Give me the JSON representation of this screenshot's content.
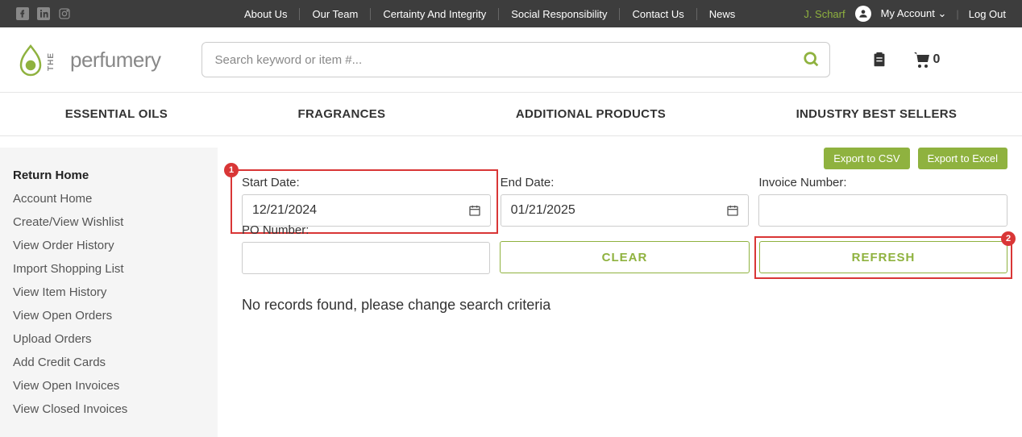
{
  "topbar": {
    "nav": [
      "About Us",
      "Our Team",
      "Certainty And Integrity",
      "Social Responsibility",
      "Contact Us",
      "News"
    ],
    "username": "J. Scharf",
    "myAccount": "My Account",
    "logout": "Log Out"
  },
  "header": {
    "logoText": "perfumery",
    "logoThe": "THE",
    "searchPlaceholder": "Search keyword or item #...",
    "cartCount": "0"
  },
  "mainNav": [
    "ESSENTIAL OILS",
    "FRAGRANCES",
    "ADDITIONAL PRODUCTS",
    "INDUSTRY BEST SELLERS"
  ],
  "sidebar": {
    "items": [
      {
        "label": "Return Home",
        "active": true
      },
      {
        "label": "Account Home",
        "active": false
      },
      {
        "label": "Create/View Wishlist",
        "active": false
      },
      {
        "label": "View Order History",
        "active": false
      },
      {
        "label": "Import Shopping List",
        "active": false
      },
      {
        "label": "View Item History",
        "active": false
      },
      {
        "label": "View Open Orders",
        "active": false
      },
      {
        "label": "Upload Orders",
        "active": false
      },
      {
        "label": "Add Credit Cards",
        "active": false
      },
      {
        "label": "View Open Invoices",
        "active": false
      },
      {
        "label": "View Closed Invoices",
        "active": false
      }
    ]
  },
  "filters": {
    "exportCsv": "Export to CSV",
    "exportExcel": "Export to Excel",
    "startDateLabel": "Start Date:",
    "startDateValue": "12/21/2024",
    "endDateLabel": "End Date:",
    "endDateValue": "01/21/2025",
    "invoiceLabel": "Invoice Number:",
    "invoiceValue": "",
    "poLabel": "PO Number:",
    "poValue": "",
    "clearBtn": "CLEAR",
    "refreshBtn": "REFRESH",
    "noRecords": "No records found, please change search criteria"
  },
  "annotations": {
    "badge1": "1",
    "badge2": "2"
  }
}
